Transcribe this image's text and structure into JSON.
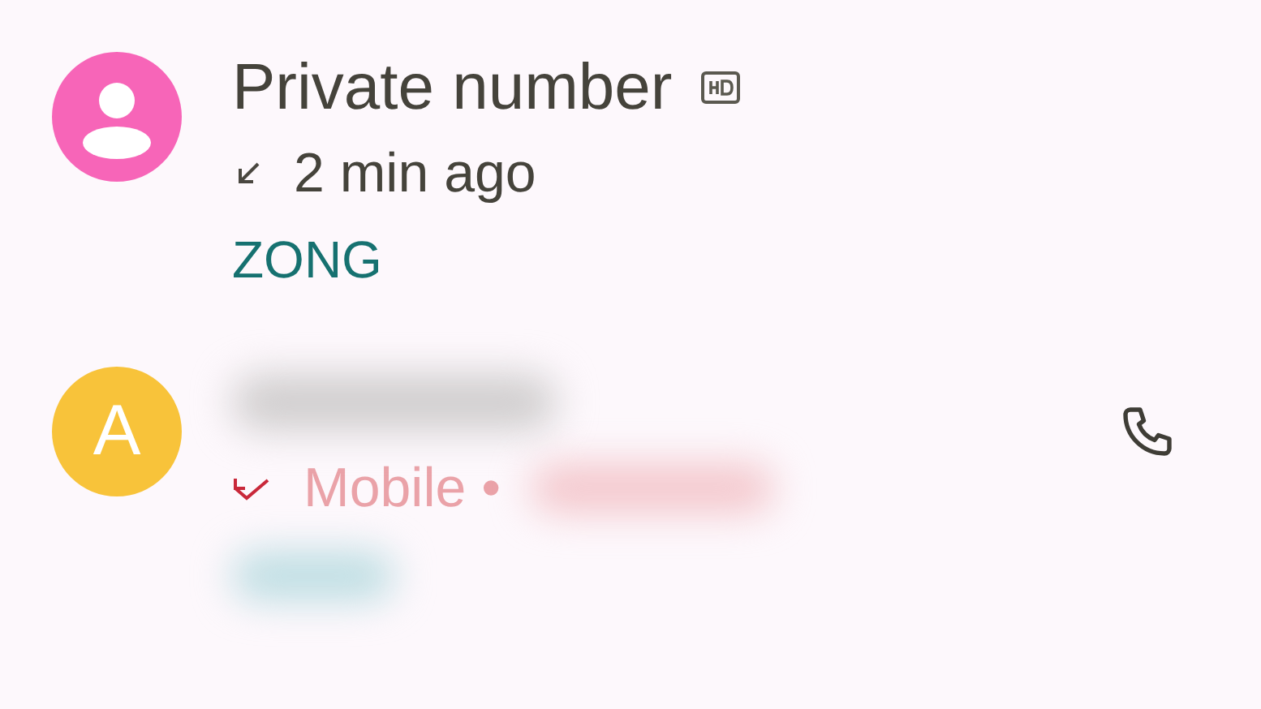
{
  "calls": [
    {
      "avatar": {
        "kind": "person",
        "color": "#f765b8"
      },
      "name": "Private number",
      "hd": true,
      "kind": "incoming",
      "detail": "2 min ago",
      "carrier": "ZONG",
      "call_button": false
    },
    {
      "avatar": {
        "kind": "letter",
        "letter": "A",
        "color": "#f8c33a"
      },
      "kind": "missed",
      "detail": "Mobile •",
      "call_button": true
    }
  ]
}
